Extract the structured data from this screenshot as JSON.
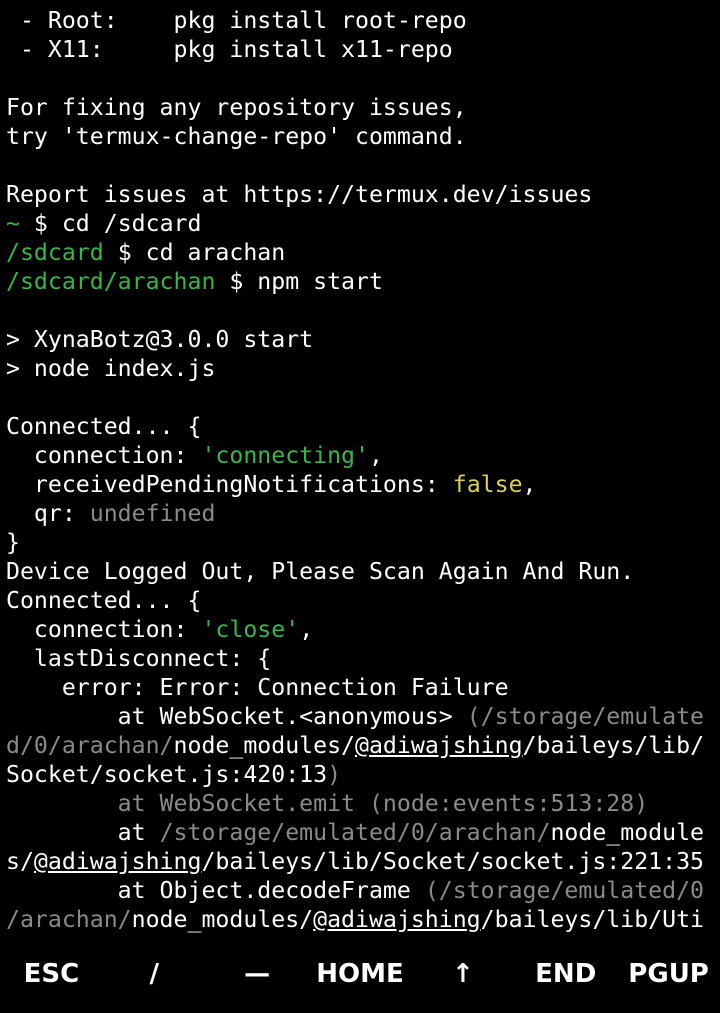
{
  "terminal": {
    "lines": [
      [
        {
          "t": " - Root:    pkg install root-repo",
          "c": ""
        }
      ],
      [
        {
          "t": " - X11:     pkg install x11-repo",
          "c": ""
        }
      ],
      [
        {
          "t": "",
          "c": ""
        }
      ],
      [
        {
          "t": "For fixing any repository issues,",
          "c": ""
        }
      ],
      [
        {
          "t": "try 'termux-change-repo' command.",
          "c": ""
        }
      ],
      [
        {
          "t": "",
          "c": ""
        }
      ],
      [
        {
          "t": "Report issues at https://termux.dev/issues",
          "c": ""
        }
      ],
      [
        {
          "t": "~",
          "c": "g"
        },
        {
          "t": " $ cd /sdcard",
          "c": ""
        }
      ],
      [
        {
          "t": "/sdcard",
          "c": "g"
        },
        {
          "t": " $ cd arachan",
          "c": ""
        }
      ],
      [
        {
          "t": "/sdcard/arachan",
          "c": "g"
        },
        {
          "t": " $ npm start",
          "c": ""
        }
      ],
      [
        {
          "t": "",
          "c": ""
        }
      ],
      [
        {
          "t": "> XynaBotz@3.0.0 start",
          "c": ""
        }
      ],
      [
        {
          "t": "> node index.js",
          "c": ""
        }
      ],
      [
        {
          "t": "",
          "c": ""
        }
      ],
      [
        {
          "t": "Connected... {",
          "c": ""
        }
      ],
      [
        {
          "t": "  connection: ",
          "c": ""
        },
        {
          "t": "'connecting'",
          "c": "g"
        },
        {
          "t": ",",
          "c": ""
        }
      ],
      [
        {
          "t": "  receivedPendingNotifications: ",
          "c": ""
        },
        {
          "t": "false",
          "c": "y"
        },
        {
          "t": ",",
          "c": ""
        }
      ],
      [
        {
          "t": "  qr: ",
          "c": ""
        },
        {
          "t": "undefined",
          "c": "d"
        }
      ],
      [
        {
          "t": "}",
          "c": ""
        }
      ],
      [
        {
          "t": "Device Logged Out, Please Scan Again And Run.",
          "c": ""
        }
      ],
      [
        {
          "t": "Connected... {",
          "c": ""
        }
      ],
      [
        {
          "t": "  connection: ",
          "c": ""
        },
        {
          "t": "'close'",
          "c": "g"
        },
        {
          "t": ",",
          "c": ""
        }
      ],
      [
        {
          "t": "  lastDisconnect: {",
          "c": ""
        }
      ],
      [
        {
          "t": "    error: Error: Connection Failure",
          "c": ""
        }
      ],
      [
        {
          "t": "        at WebSocket.<anonymous> ",
          "c": ""
        },
        {
          "t": "(/storage/emulate",
          "c": "d"
        }
      ],
      [
        {
          "t": "d/0/arachan/",
          "c": "d"
        },
        {
          "t": "node_modules/",
          "c": ""
        },
        {
          "t": "@adiwajshing",
          "c": "u"
        },
        {
          "t": "/baileys/lib/",
          "c": ""
        }
      ],
      [
        {
          "t": "Socket/socket.js:420:13",
          "c": ""
        },
        {
          "t": ")",
          "c": "d"
        }
      ],
      [
        {
          "t": "        at WebSocket.emit (node:events:513:28)",
          "c": "d"
        }
      ],
      [
        {
          "t": "        at ",
          "c": ""
        },
        {
          "t": "/storage/emulated/0/arachan/",
          "c": "d"
        },
        {
          "t": "node_module",
          "c": ""
        }
      ],
      [
        {
          "t": "s/",
          "c": ""
        },
        {
          "t": "@adiwajshing",
          "c": "u"
        },
        {
          "t": "/baileys/lib/Socket/socket.js:221:35",
          "c": ""
        }
      ],
      [
        {
          "t": "        at Object.decodeFrame ",
          "c": ""
        },
        {
          "t": "(/storage/emulated/0",
          "c": "d"
        }
      ],
      [
        {
          "t": "/arachan/",
          "c": "d"
        },
        {
          "t": "node_modules/",
          "c": ""
        },
        {
          "t": "@adiwajshing",
          "c": "u"
        },
        {
          "t": "/baileys/lib/Uti",
          "c": ""
        }
      ]
    ]
  },
  "extra_keys": {
    "esc": "ESC",
    "slash": "/",
    "dash": "—",
    "home": "HOME",
    "up": "↑",
    "end": "END",
    "pgup": "PGUP"
  },
  "colors": {
    "background": "#000000",
    "text": "#ffffff",
    "prompt_path": "#39b54a",
    "string": "#39b54a",
    "boolean": "#d9cf56",
    "dim": "#8a8a8a"
  }
}
